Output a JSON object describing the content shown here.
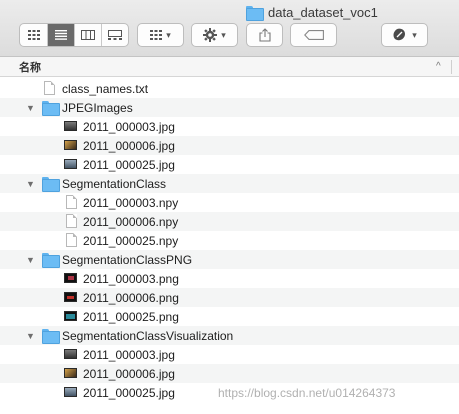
{
  "window": {
    "title": "data_dataset_voc1",
    "title_icon": "folder-icon"
  },
  "toolbar": {
    "view_buttons": [
      "icon-view-icon",
      "list-view-icon",
      "column-view-icon",
      "gallery-view-icon"
    ],
    "active_view": "list",
    "group_button": "group-grid-icon",
    "action_button": "gear-icon",
    "share_button": "share-icon",
    "tag_button": "tag-icon",
    "dropbox_button": "dropbox-icon"
  },
  "header": {
    "name_column": "名称",
    "sort_indicator": "^"
  },
  "files": [
    {
      "name": "class_names.txt",
      "kind": "doc",
      "level": 0
    },
    {
      "name": "JPEGImages",
      "kind": "folder",
      "level": 0,
      "expanded": true
    },
    {
      "name": "2011_000003.jpg",
      "kind": "jpg1",
      "level": 1
    },
    {
      "name": "2011_000006.jpg",
      "kind": "jpg2",
      "level": 1
    },
    {
      "name": "2011_000025.jpg",
      "kind": "jpg3",
      "level": 1
    },
    {
      "name": "SegmentationClass",
      "kind": "folder",
      "level": 0,
      "expanded": true
    },
    {
      "name": "2011_000003.npy",
      "kind": "doc",
      "level": 1
    },
    {
      "name": "2011_000006.npy",
      "kind": "doc",
      "level": 1
    },
    {
      "name": "2011_000025.npy",
      "kind": "doc",
      "level": 1
    },
    {
      "name": "SegmentationClassPNG",
      "kind": "folder",
      "level": 0,
      "expanded": true
    },
    {
      "name": "2011_000003.png",
      "kind": "png1",
      "level": 1
    },
    {
      "name": "2011_000006.png",
      "kind": "png2",
      "level": 1
    },
    {
      "name": "2011_000025.png",
      "kind": "png3",
      "level": 1
    },
    {
      "name": "SegmentationClassVisualization",
      "kind": "folder",
      "level": 0,
      "expanded": true
    },
    {
      "name": "2011_000003.jpg",
      "kind": "jpg1",
      "level": 1
    },
    {
      "name": "2011_000006.jpg",
      "kind": "jpg2",
      "level": 1
    },
    {
      "name": "2011_000025.jpg",
      "kind": "jpg3",
      "level": 1
    }
  ],
  "watermark": "https://blog.csdn.net/u014264373"
}
